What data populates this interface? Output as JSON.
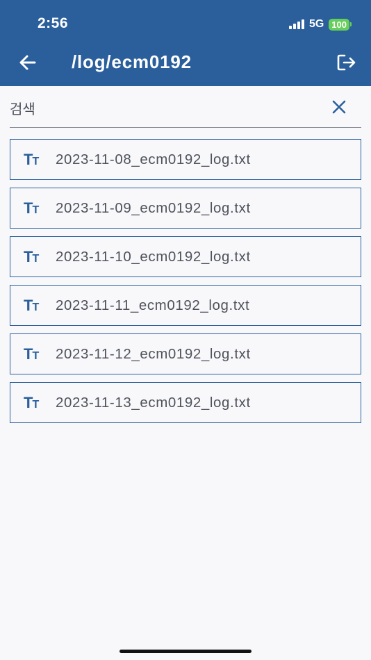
{
  "status_bar": {
    "time": "2:56",
    "network": "5G",
    "battery": "100",
    "colors": {
      "battery": "#67cf59"
    }
  },
  "header": {
    "title": "/log/ecm0192",
    "back_icon": "arrow-left-icon",
    "logout_icon": "logout-icon"
  },
  "search": {
    "placeholder": "검색",
    "value": "",
    "clear_icon": "close-icon"
  },
  "files": [
    {
      "icon": "text-format-icon",
      "name": "2023-11-08_ecm0192_log.txt"
    },
    {
      "icon": "text-format-icon",
      "name": "2023-11-09_ecm0192_log.txt"
    },
    {
      "icon": "text-format-icon",
      "name": "2023-11-10_ecm0192_log.txt"
    },
    {
      "icon": "text-format-icon",
      "name": "2023-11-11_ecm0192_log.txt"
    },
    {
      "icon": "text-format-icon",
      "name": "2023-11-12_ecm0192_log.txt"
    },
    {
      "icon": "text-format-icon",
      "name": "2023-11-13_ecm0192_log.txt"
    }
  ],
  "colors": {
    "primary": "#2a5f9c",
    "background": "#f8f8fb",
    "text": "#4f535b"
  }
}
